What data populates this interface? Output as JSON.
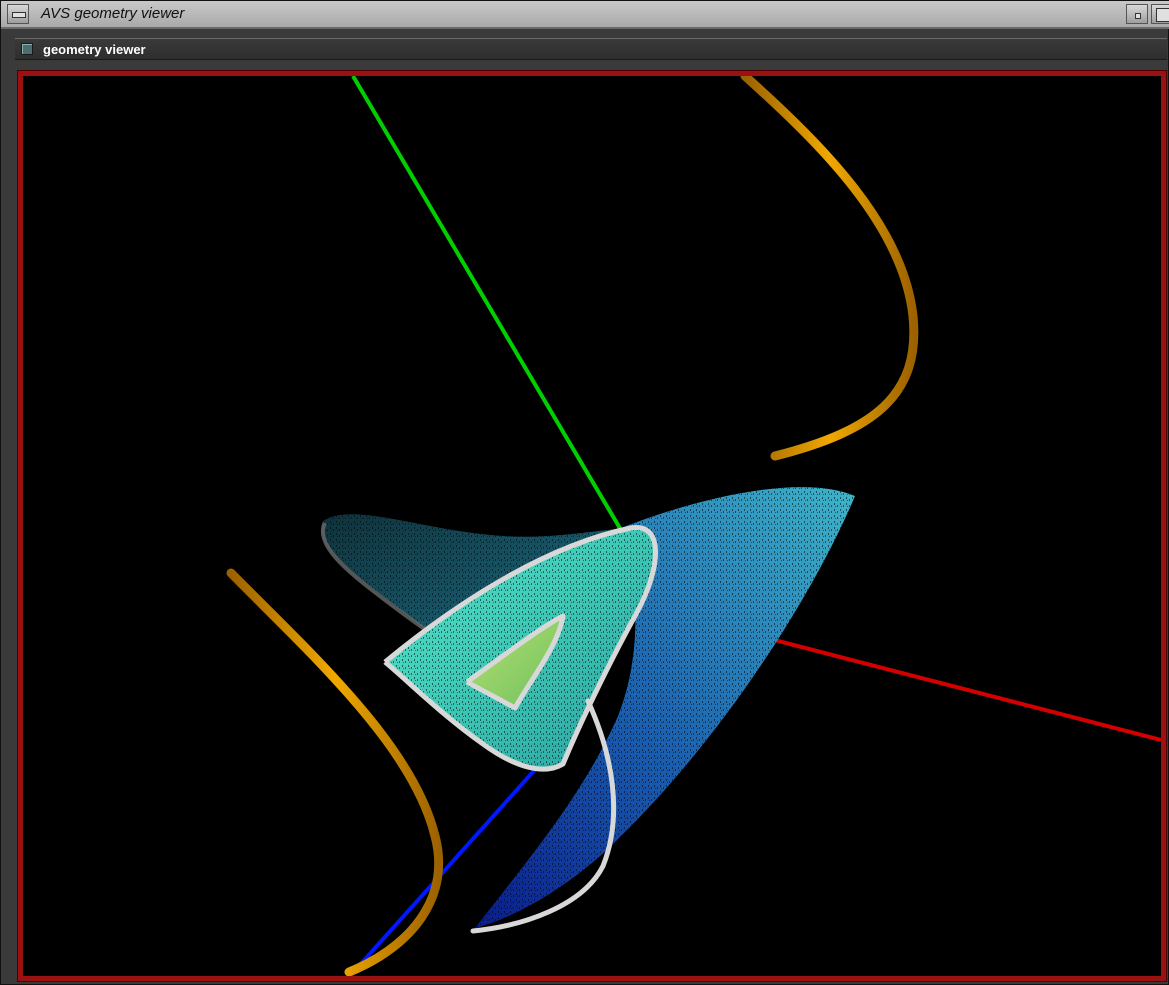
{
  "window": {
    "title": "AVS geometry viewer"
  },
  "panel": {
    "label": "geometry viewer"
  },
  "viewer": {
    "background_color": "#000000",
    "frame_color": "#9b1010",
    "axes": {
      "x_color": "#d40000",
      "y_color": "#00d000",
      "z_color": "#0018ff"
    },
    "tube_color": "#e49a00",
    "outline_color": "#d8d8d8",
    "surface_colors": [
      "#1a2fb0",
      "#1e6fb8",
      "#2ab0c0",
      "#40e0c0",
      "#90e070"
    ]
  },
  "icons": {
    "menu": "window-menu-icon",
    "minimize": "minimize-icon",
    "maximize": "maximize-icon",
    "panel_toggle": "panel-toggle-icon"
  }
}
